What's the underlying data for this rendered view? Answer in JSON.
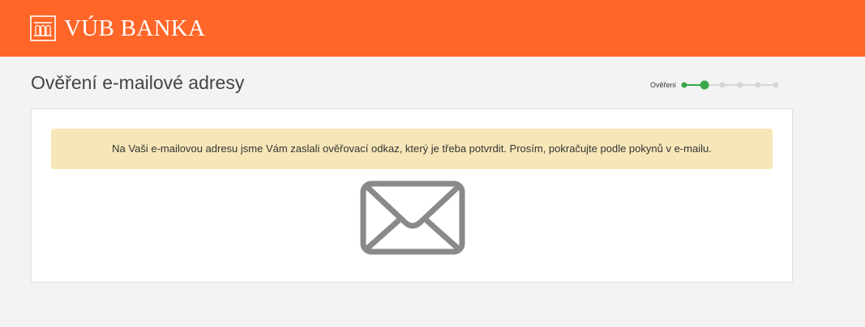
{
  "header": {
    "brand_name": "VÚB BANKA",
    "brand_logo_icon": "bank-building-icon",
    "background_color": "#ff6628"
  },
  "page": {
    "title": "Ověření e-mailové adresy"
  },
  "progress": {
    "current_step_label": "Ověření",
    "total_steps": 6,
    "current_step": 2,
    "active_color": "#3aa84a",
    "inactive_color": "#d6d6d6"
  },
  "alert": {
    "message": "Na Vaši e-mailovou adresu jsme Vám zaslali ověřovací odkaz, který je třeba potvrdit. Prosím, pokračujte podle pokynů v e-mailu.",
    "background_color": "#f7e7b8"
  },
  "illustration": {
    "icon": "envelope-icon",
    "color": "#8a8a8a"
  }
}
